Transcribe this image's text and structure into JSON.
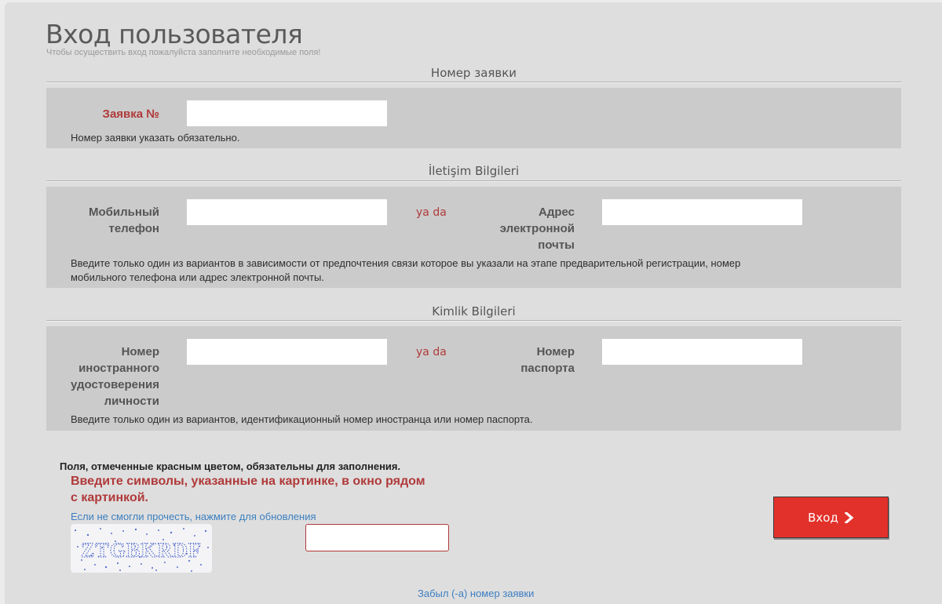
{
  "header": {
    "title": "Вход пользователя",
    "subtitle": "Чтобы осуществить вход пожалуйста заполните необходимые поля!"
  },
  "sections": {
    "application": {
      "title": "Номер заявки",
      "label": "Заявка №",
      "value": "",
      "hint": "Номер заявки указать обязательно."
    },
    "contact": {
      "title": "İletişim Bilgileri",
      "phone_label_1": "Мобильный",
      "phone_label_2": "телефон",
      "phone_value": "",
      "or_text": "ya da",
      "email_label_1": "Адрес",
      "email_label_2": "электронной",
      "email_label_3": "почты",
      "email_value": "",
      "hint": "Введите только один из вариантов в зависимости от предпочтения связи которое вы указали на этапе предварительной регистрации, номер мобильного телефона или адрес электронной почты."
    },
    "identity": {
      "title": "Kimlik Bilgileri",
      "foreign_id_label_1": "Номер",
      "foreign_id_label_2": "иностранного",
      "foreign_id_label_3": "удостоверения",
      "foreign_id_label_4": "личности",
      "foreign_id_value": "",
      "or_text": "ya da",
      "passport_label_1": "Номер",
      "passport_label_2": "паспорта",
      "passport_value": "",
      "hint": "Введите только один из вариантов, идентификационный номер иностранца или номер паспорта."
    }
  },
  "form_footer": {
    "required_note": "Поля, отмеченные красным цветом, обязательны для заполнения.",
    "captcha_title": "Введите символы, указанные на картинке, в окно рядом с картинкой.",
    "captcha_refresh_link": "Если не смогли прочесть, нажмите для обновления",
    "captcha_text": "ZTGBKRDF",
    "captcha_value": "",
    "submit_label": "Вход",
    "submit_icon": "chevron-right-icon",
    "forgot_link": "Забыл (-а) номер заявки"
  },
  "colors": {
    "page_bg": "#dedede",
    "panel_bg": "#cccbcb",
    "accent_red": "#b03a3a",
    "button_red": "#e2312a",
    "link_blue": "#3d7fc0"
  }
}
